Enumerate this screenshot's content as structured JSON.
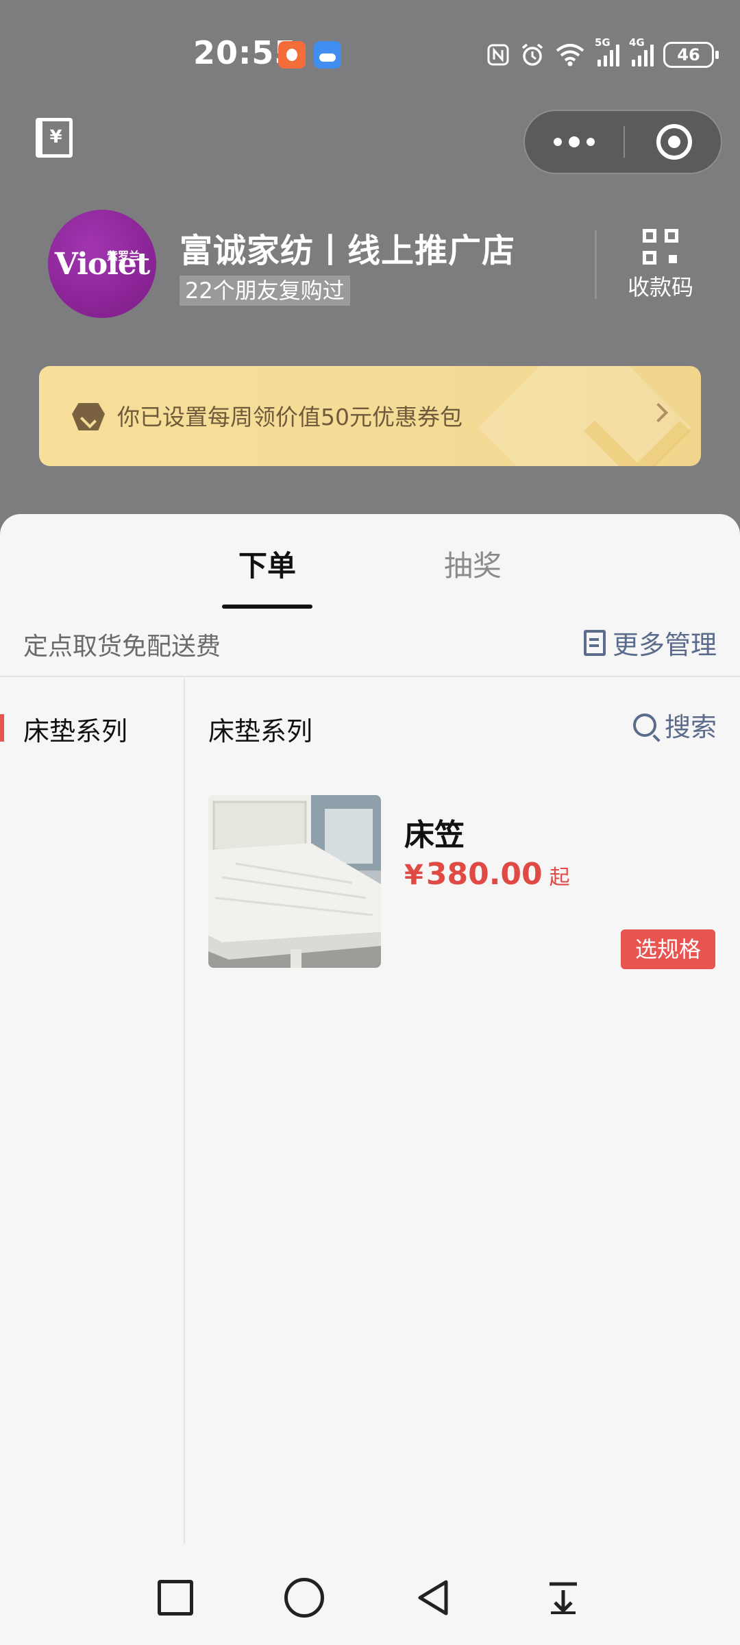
{
  "status_bar": {
    "time": "20:55",
    "icons": [
      "app-notification-icon",
      "weather-icon",
      "nfc-icon",
      "alarm-icon",
      "wifi-icon",
      "signal-5g-icon",
      "signal-4g-icon"
    ],
    "sig1_label": "5G",
    "sig2_label": "4G",
    "battery": "46"
  },
  "top_nav": {
    "ledger_symbol": "¥"
  },
  "shop": {
    "avatar_text": "Violet",
    "avatar_subtext": "紫罗兰",
    "name": "富诚家纺丨线上推广店",
    "repurchase": "22个朋友复购过",
    "qr_label": "收款码"
  },
  "coupon": {
    "text": "你已设置每周领价值50元优惠券包"
  },
  "tabs": [
    {
      "label": "下单",
      "active": true
    },
    {
      "label": "抽奖",
      "active": false
    }
  ],
  "pickup": {
    "text": "定点取货免配送费",
    "manage_label": "更多管理"
  },
  "sidebar": {
    "categories": [
      {
        "label": "床垫系列",
        "active": true
      }
    ]
  },
  "content": {
    "section_title": "床垫系列",
    "search_label": "搜索",
    "products": [
      {
        "name": "床笠",
        "currency": "¥",
        "price": "380.00",
        "price_suffix": "起",
        "button_label": "选规格"
      }
    ]
  },
  "colors": {
    "accent_red": "#e85550",
    "price_red": "#e04a45",
    "link_blue_gray": "#5b6b8b",
    "header_gray": "#7d7d7f",
    "coupon_gold": "#f4db96"
  }
}
